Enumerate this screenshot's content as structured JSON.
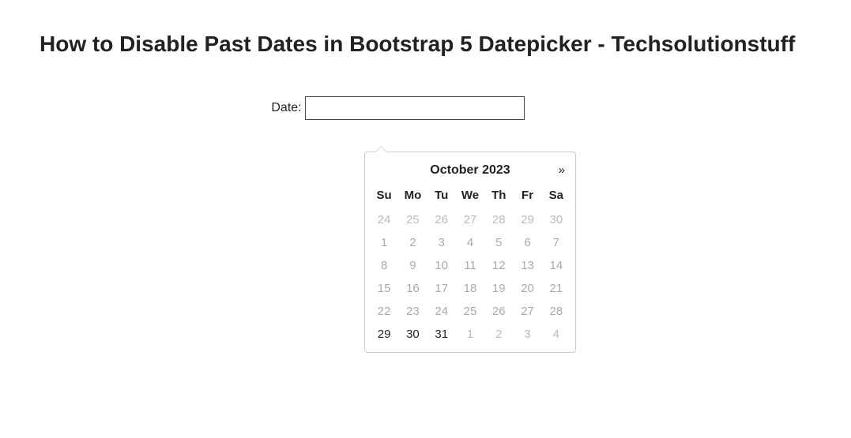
{
  "title": "How to Disable Past Dates in Bootstrap 5 Datepicker - Techsolutionstuff",
  "form": {
    "label": "Date:",
    "value": "",
    "placeholder": ""
  },
  "datepicker": {
    "month_title": "October 2023",
    "next_symbol": "»",
    "dow": [
      "Su",
      "Mo",
      "Tu",
      "We",
      "Th",
      "Fr",
      "Sa"
    ],
    "weeks": [
      [
        {
          "d": "24",
          "state": "disabled other-month"
        },
        {
          "d": "25",
          "state": "disabled other-month"
        },
        {
          "d": "26",
          "state": "disabled other-month"
        },
        {
          "d": "27",
          "state": "disabled other-month"
        },
        {
          "d": "28",
          "state": "disabled other-month"
        },
        {
          "d": "29",
          "state": "disabled other-month"
        },
        {
          "d": "30",
          "state": "disabled other-month"
        }
      ],
      [
        {
          "d": "1",
          "state": "disabled"
        },
        {
          "d": "2",
          "state": "disabled"
        },
        {
          "d": "3",
          "state": "disabled"
        },
        {
          "d": "4",
          "state": "disabled"
        },
        {
          "d": "5",
          "state": "disabled"
        },
        {
          "d": "6",
          "state": "disabled"
        },
        {
          "d": "7",
          "state": "disabled"
        }
      ],
      [
        {
          "d": "8",
          "state": "disabled"
        },
        {
          "d": "9",
          "state": "disabled"
        },
        {
          "d": "10",
          "state": "disabled"
        },
        {
          "d": "11",
          "state": "disabled"
        },
        {
          "d": "12",
          "state": "disabled"
        },
        {
          "d": "13",
          "state": "disabled"
        },
        {
          "d": "14",
          "state": "disabled"
        }
      ],
      [
        {
          "d": "15",
          "state": "disabled"
        },
        {
          "d": "16",
          "state": "disabled"
        },
        {
          "d": "17",
          "state": "disabled"
        },
        {
          "d": "18",
          "state": "disabled"
        },
        {
          "d": "19",
          "state": "disabled"
        },
        {
          "d": "20",
          "state": "disabled"
        },
        {
          "d": "21",
          "state": "disabled"
        }
      ],
      [
        {
          "d": "22",
          "state": "disabled"
        },
        {
          "d": "23",
          "state": "disabled"
        },
        {
          "d": "24",
          "state": "disabled"
        },
        {
          "d": "25",
          "state": "disabled"
        },
        {
          "d": "26",
          "state": "disabled"
        },
        {
          "d": "27",
          "state": "disabled"
        },
        {
          "d": "28",
          "state": "disabled"
        }
      ],
      [
        {
          "d": "29",
          "state": "enabled"
        },
        {
          "d": "30",
          "state": "enabled"
        },
        {
          "d": "31",
          "state": "enabled"
        },
        {
          "d": "1",
          "state": "disabled other-month"
        },
        {
          "d": "2",
          "state": "disabled other-month"
        },
        {
          "d": "3",
          "state": "disabled other-month"
        },
        {
          "d": "4",
          "state": "disabled other-month"
        }
      ]
    ]
  }
}
